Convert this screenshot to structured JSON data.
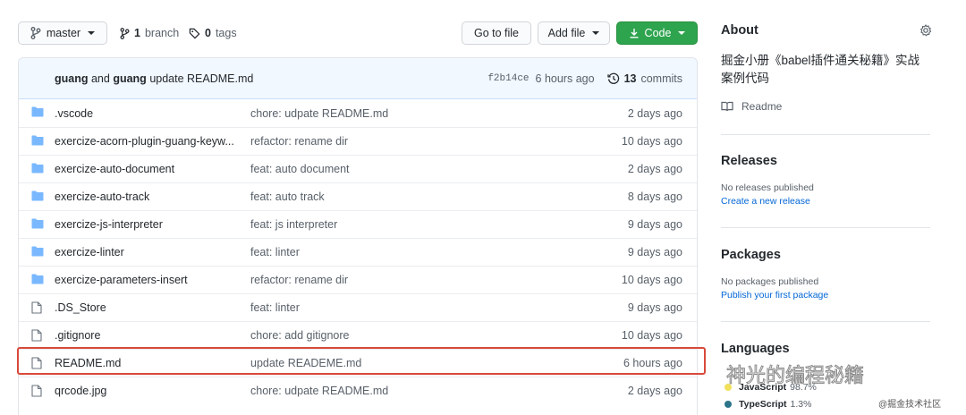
{
  "toolbar": {
    "branch_select": "master",
    "branches_count": "1",
    "branches_label": "branch",
    "tags_count": "0",
    "tags_label": "tags",
    "go_to_file": "Go to file",
    "add_file": "Add file",
    "code": "Code"
  },
  "commit": {
    "author1": "guang",
    "and": "and",
    "author2": "guang",
    "message": "update README.md",
    "sha": "f2b14ce",
    "ago": "6 hours ago",
    "commits_count": "13",
    "commits_label": "commits"
  },
  "files": [
    {
      "type": "folder",
      "name": ".vscode",
      "message": "chore: udpate README.md",
      "time": "2 days ago"
    },
    {
      "type": "folder",
      "name": "exercize-acorn-plugin-guang-keyw...",
      "message": "refactor: rename dir",
      "time": "10 days ago"
    },
    {
      "type": "folder",
      "name": "exercize-auto-document",
      "message": "feat: auto document",
      "time": "2 days ago"
    },
    {
      "type": "folder",
      "name": "exercize-auto-track",
      "message": "feat: auto track",
      "time": "8 days ago"
    },
    {
      "type": "folder",
      "name": "exercize-js-interpreter",
      "message": "feat: js interpreter",
      "time": "9 days ago"
    },
    {
      "type": "folder",
      "name": "exercize-linter",
      "message": "feat: linter",
      "time": "9 days ago"
    },
    {
      "type": "folder",
      "name": "exercize-parameters-insert",
      "message": "refactor: rename dir",
      "time": "10 days ago"
    },
    {
      "type": "file",
      "name": ".DS_Store",
      "message": "feat: linter",
      "time": "9 days ago"
    },
    {
      "type": "file",
      "name": ".gitignore",
      "message": "chore: add gitignore",
      "time": "10 days ago"
    },
    {
      "type": "file",
      "name": "README.md",
      "message": "update READEME.md",
      "time": "6 hours ago"
    },
    {
      "type": "file",
      "name": "qrcode.jpg",
      "message": "chore: udpate README.md",
      "time": "2 days ago"
    }
  ],
  "about": {
    "title": "About",
    "description_line1": "掘金小册《babel插件通关秘籍》实战",
    "description_line2": "案例代码",
    "readme": "Readme"
  },
  "releases": {
    "title": "Releases",
    "none": "No releases published",
    "create": "Create a new release"
  },
  "packages": {
    "title": "Packages",
    "none": "No packages published",
    "publish": "Publish your first package"
  },
  "languages": {
    "title": "Languages",
    "items": [
      {
        "name": "JavaScript",
        "percent": "98.7%",
        "color": "#f1e05a"
      },
      {
        "name": "TypeScript",
        "percent": "1.3%",
        "color": "#2b7489"
      }
    ]
  },
  "watermark": {
    "main": "神光的编程秘籍",
    "sub": "@掘金技术社区"
  },
  "colors": {
    "green": "#2ea44f",
    "link": "#0366d6",
    "folder": "#79b8ff",
    "highlight": "#d84a3b"
  }
}
